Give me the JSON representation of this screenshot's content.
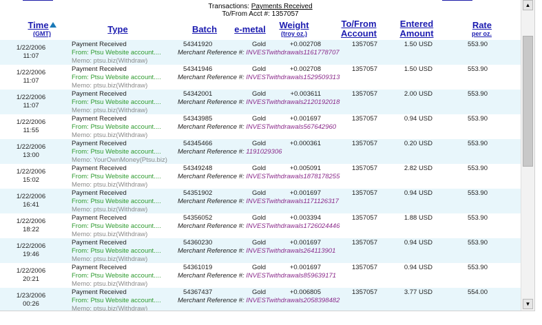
{
  "header_info": {
    "transactions_label": "Transactions:",
    "transactions_value": "Payments Received",
    "acct_label": "To/From Acct #:",
    "acct_value": "1357057"
  },
  "columns": {
    "time": "Time",
    "time_sub": "(GMT)",
    "type": "Type",
    "batch": "Batch",
    "emetal": "e-metal",
    "weight": "Weight",
    "weight_sub": "(troy oz.)",
    "tofrom_line1": "To/From",
    "tofrom_line2": "Account",
    "entered_line1": "Entered",
    "entered_line2": "Amount",
    "rate": "Rate",
    "rate_sub": "per oz."
  },
  "rows": [
    {
      "date": "1/22/2006",
      "time": "11:07",
      "type": "Payment Received",
      "from": "From: Ptsu Website account....",
      "memo": "Memo: ptsu.biz(Withdraw)",
      "batch": "54341920",
      "metal": "Gold",
      "ref_label": "Merchant Reference #:",
      "ref": "INVESTwithdrawals1161778707",
      "weight": "+0.002708",
      "acct": "1357057",
      "amount": "1.50 USD",
      "rate": "553.90"
    },
    {
      "date": "1/22/2006",
      "time": "11:07",
      "type": "Payment Received",
      "from": "From: Ptsu Website account....",
      "memo": "Memo: ptsu.biz(Withdraw)",
      "batch": "54341946",
      "metal": "Gold",
      "ref_label": "Merchant Reference #:",
      "ref": "INVESTwithdrawals1529509313",
      "weight": "+0.002708",
      "acct": "1357057",
      "amount": "1.50 USD",
      "rate": "553.90"
    },
    {
      "date": "1/22/2006",
      "time": "11:07",
      "type": "Payment Received",
      "from": "From: Ptsu Website account....",
      "memo": "Memo: ptsu.biz(Withdraw)",
      "batch": "54342001",
      "metal": "Gold",
      "ref_label": "Merchant Reference #:",
      "ref": "INVESTwithdrawals2120192018",
      "weight": "+0.003611",
      "acct": "1357057",
      "amount": "2.00 USD",
      "rate": "553.90"
    },
    {
      "date": "1/22/2006",
      "time": "11:55",
      "type": "Payment Received",
      "from": "From: Ptsu Website account....",
      "memo": "Memo: ptsu.biz(Withdraw)",
      "batch": "54343985",
      "metal": "Gold",
      "ref_label": "Merchant Reference #:",
      "ref": "INVESTwithdrawals567642960",
      "weight": "+0.001697",
      "acct": "1357057",
      "amount": "0.94 USD",
      "rate": "553.90"
    },
    {
      "date": "1/22/2006",
      "time": "13:00",
      "type": "Payment Received",
      "from": "From: Ptsu Website account....",
      "memo": "Memo: YourOwnMoney(Ptsu.biz)",
      "batch": "54345466",
      "metal": "Gold",
      "ref_label": "Merchant Reference #:",
      "ref": "1191029306",
      "weight": "+0.000361",
      "acct": "1357057",
      "amount": "0.20 USD",
      "rate": "553.90"
    },
    {
      "date": "1/22/2006",
      "time": "15:02",
      "type": "Payment Received",
      "from": "From: Ptsu Website account....",
      "memo": "Memo: ptsu.biz(Withdraw)",
      "batch": "54349248",
      "metal": "Gold",
      "ref_label": "Merchant Reference #:",
      "ref": "INVESTwithdrawals1878178255",
      "weight": "+0.005091",
      "acct": "1357057",
      "amount": "2.82 USD",
      "rate": "553.90"
    },
    {
      "date": "1/22/2006",
      "time": "16:41",
      "type": "Payment Received",
      "from": "From: Ptsu Website account....",
      "memo": "Memo: ptsu.biz(Withdraw)",
      "batch": "54351902",
      "metal": "Gold",
      "ref_label": "Merchant Reference #:",
      "ref": "INVESTwithdrawals1171126317",
      "weight": "+0.001697",
      "acct": "1357057",
      "amount": "0.94 USD",
      "rate": "553.90"
    },
    {
      "date": "1/22/2006",
      "time": "18:22",
      "type": "Payment Received",
      "from": "From: Ptsu Website account....",
      "memo": "Memo: ptsu.biz(Withdraw)",
      "batch": "54356052",
      "metal": "Gold",
      "ref_label": "Merchant Reference #:",
      "ref": "INVESTwithdrawals1726024446",
      "weight": "+0.003394",
      "acct": "1357057",
      "amount": "1.88 USD",
      "rate": "553.90"
    },
    {
      "date": "1/22/2006",
      "time": "19:46",
      "type": "Payment Received",
      "from": "From: Ptsu Website account....",
      "memo": "Memo: ptsu.biz(Withdraw)",
      "batch": "54360230",
      "metal": "Gold",
      "ref_label": "Merchant Reference #:",
      "ref": "INVESTwithdrawals264113901",
      "weight": "+0.001697",
      "acct": "1357057",
      "amount": "0.94 USD",
      "rate": "553.90"
    },
    {
      "date": "1/22/2006",
      "time": "20:21",
      "type": "Payment Received",
      "from": "From: Ptsu Website account....",
      "memo": "Memo: ptsu.biz(Withdraw)",
      "batch": "54361019",
      "metal": "Gold",
      "ref_label": "Merchant Reference #:",
      "ref": "INVESTwithdrawals859639171",
      "weight": "+0.001697",
      "acct": "1357057",
      "amount": "0.94 USD",
      "rate": "553.90"
    },
    {
      "date": "1/23/2006",
      "time": "00:26",
      "type": "Payment Received",
      "from": "From: Ptsu Website account....",
      "memo": "Memo: ptsu.biz(Withdraw)",
      "batch": "54367437",
      "metal": "Gold",
      "ref_label": "Merchant Reference #:",
      "ref": "INVESTwithdrawals2058398482",
      "weight": "+0.006805",
      "acct": "1357057",
      "amount": "3.77 USD",
      "rate": "554.00"
    }
  ],
  "colors": {
    "header_link": "#1c1cb0",
    "row_alt_bg": "#e8f6fb",
    "from_text": "#2e9a2e",
    "memo_text": "#8a8a8a",
    "ref_number": "#8a2a8a"
  },
  "icons": {
    "sort": "sort-ascending-triangle-icon",
    "scroll_up": "scroll-up-arrow-icon",
    "scroll_down": "scroll-down-arrow-icon"
  }
}
